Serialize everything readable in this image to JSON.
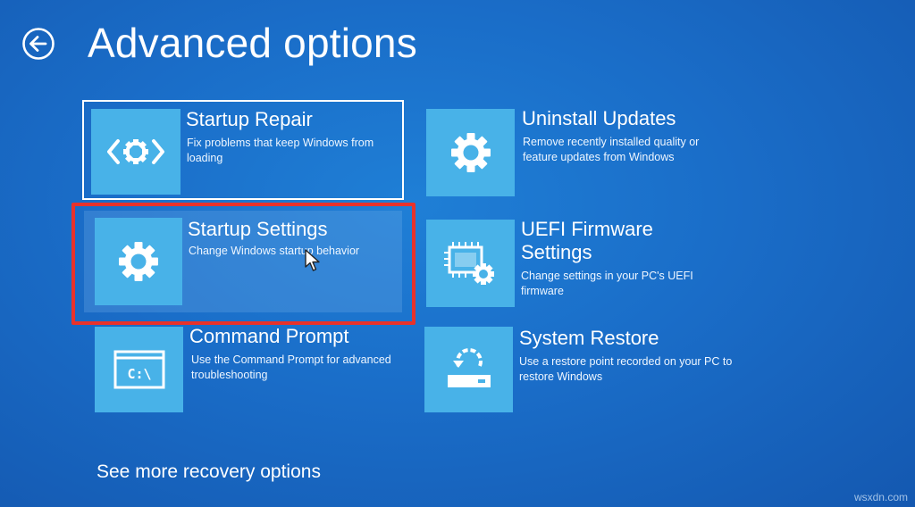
{
  "page": {
    "title": "Advanced options",
    "back_icon": "back-arrow-icon"
  },
  "options": {
    "startup_repair": {
      "name": "Startup Repair",
      "description": "Fix problems that keep Windows from loading",
      "icon": "repair-gear-brackets-icon",
      "state": "focused"
    },
    "startup_settings": {
      "name": "Startup Settings",
      "description": "Change Windows startup behavior",
      "icon": "gear-icon",
      "state": "highlighted"
    },
    "command_prompt": {
      "name": "Command Prompt",
      "description": "Use the Command Prompt for advanced troubleshooting",
      "icon": "command-prompt-icon",
      "tile_text": "C:\\"
    },
    "uninstall_updates": {
      "name": "Uninstall Updates",
      "description": "Remove recently installed quality or feature updates from Windows",
      "icon": "gear-icon"
    },
    "uefi_firmware": {
      "name": "UEFI Firmware Settings",
      "description": "Change settings in your PC's UEFI firmware",
      "icon": "firmware-chip-gear-icon"
    },
    "system_restore": {
      "name": "System Restore",
      "description": "Use a restore point recorded on your PC to restore Windows",
      "icon": "system-restore-icon"
    }
  },
  "more_link": "See more recovery options",
  "watermark": "wsxdn.com",
  "colors": {
    "background": "#1a6dc8",
    "tile": "#48b2e8",
    "highlight_border": "#e8322b",
    "text": "#ffffff"
  }
}
